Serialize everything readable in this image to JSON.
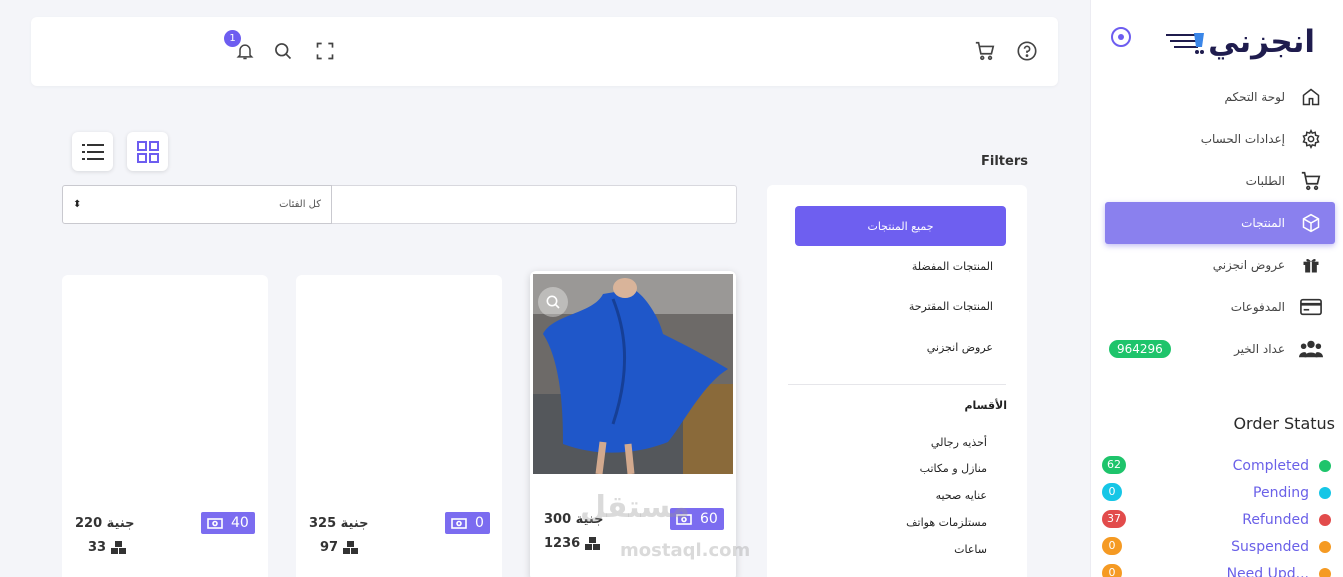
{
  "brand": {
    "logo_text": "انجزني",
    "accent": "#6d5df0"
  },
  "sidebar": {
    "items": [
      {
        "label": "لوحة التحكم",
        "icon": "home-icon"
      },
      {
        "label": "إعدادات الحساب",
        "icon": "gear-icon"
      },
      {
        "label": "الطلبات",
        "icon": "cart-icon"
      },
      {
        "label": "المنتجات",
        "icon": "box-icon",
        "active": true
      },
      {
        "label": "عروض انجزني",
        "icon": "gift-icon"
      },
      {
        "label": "المدفوعات",
        "icon": "card-icon"
      },
      {
        "label": "عداد الخير",
        "icon": "users-icon",
        "badge": "964296"
      }
    ]
  },
  "order_status": {
    "title": "Order Status",
    "items": [
      {
        "label": "Completed",
        "count": "62",
        "color": "#1ec46b"
      },
      {
        "label": "Pending",
        "count": "0",
        "color": "#16c6e6"
      },
      {
        "label": "Refunded",
        "count": "37",
        "color": "#e24b4b"
      },
      {
        "label": "Suspended",
        "count": "0",
        "color": "#f59a23"
      },
      {
        "label": "Need Upd...",
        "count": "0",
        "color": "#f59a23"
      }
    ]
  },
  "topbar": {
    "notification_count": "1"
  },
  "filters": {
    "title": "Filters",
    "primary_label": "جميع المنتجات",
    "links": [
      "المنتجات المفضلة",
      "المنتجات المقترحة",
      "عروض انجزني"
    ],
    "categories_title": "الأقسام",
    "categories": [
      "أحذيه رجالي",
      "منازل و مكاتب",
      "عنايه صحيه",
      "مستلزمات هواتف",
      "ساعات"
    ]
  },
  "search": {
    "placeholder": "",
    "category_value": "كل الفئات"
  },
  "products": [
    {
      "points": "40",
      "price": "220 جنية",
      "stock": "33",
      "has_image": false
    },
    {
      "points": "0",
      "price": "325 جنية",
      "stock": "97",
      "has_image": false
    },
    {
      "points": "60",
      "price": "300 جنية",
      "stock": "1236",
      "has_image": true
    }
  ],
  "watermark": {
    "text": "مستقل",
    "sub": "mostaql.com"
  }
}
